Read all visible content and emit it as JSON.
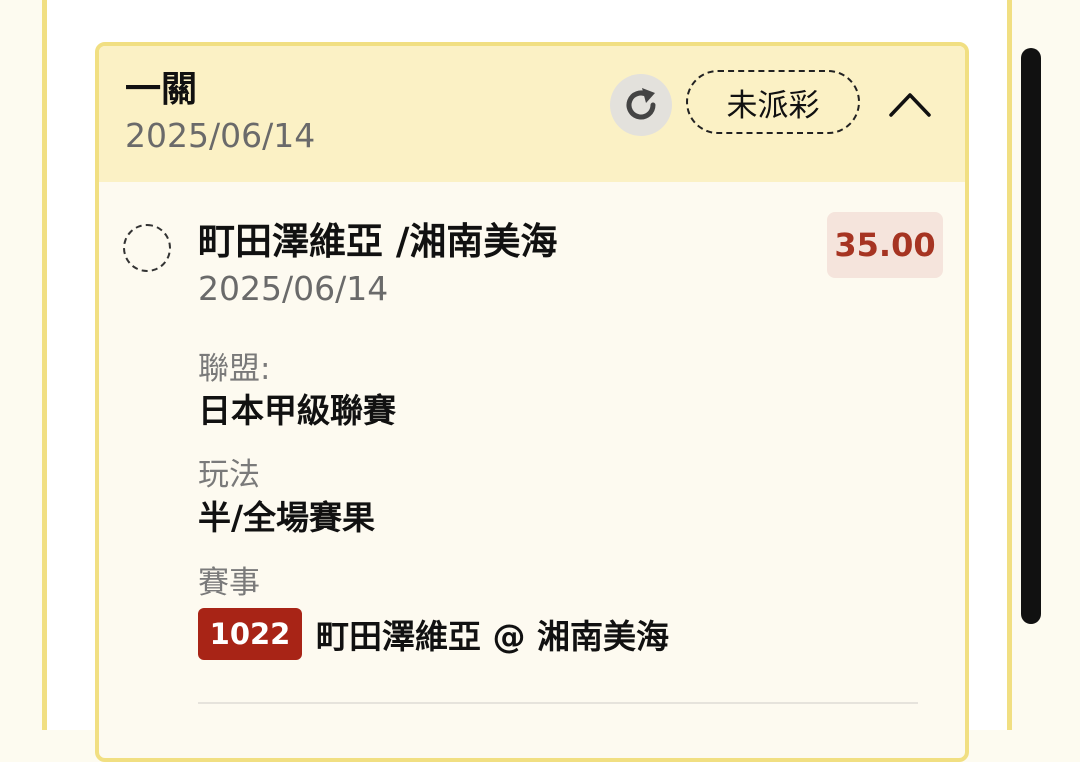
{
  "card": {
    "title": "一關",
    "date": "2025/06/14",
    "status_label": "未派彩",
    "icons": {
      "refresh": "refresh-icon",
      "collapse": "chevron-up-icon"
    }
  },
  "selection": {
    "match_title": "町田澤維亞 /湘南美海",
    "match_date": "2025/06/14",
    "odds": "35.00",
    "league_label": "聯盟:",
    "league_value": "日本甲級聯賽",
    "bet_type_label": "玩法",
    "bet_type_value": "半/全場賽果",
    "event_label": "賽事",
    "event_number": "1022",
    "event_name": "町田澤維亞 @ 湘南美海"
  },
  "colors": {
    "accent_border": "#f1df82",
    "header_bg": "#fbf1c5",
    "odds_text": "#a63422",
    "event_badge": "#a82416"
  }
}
